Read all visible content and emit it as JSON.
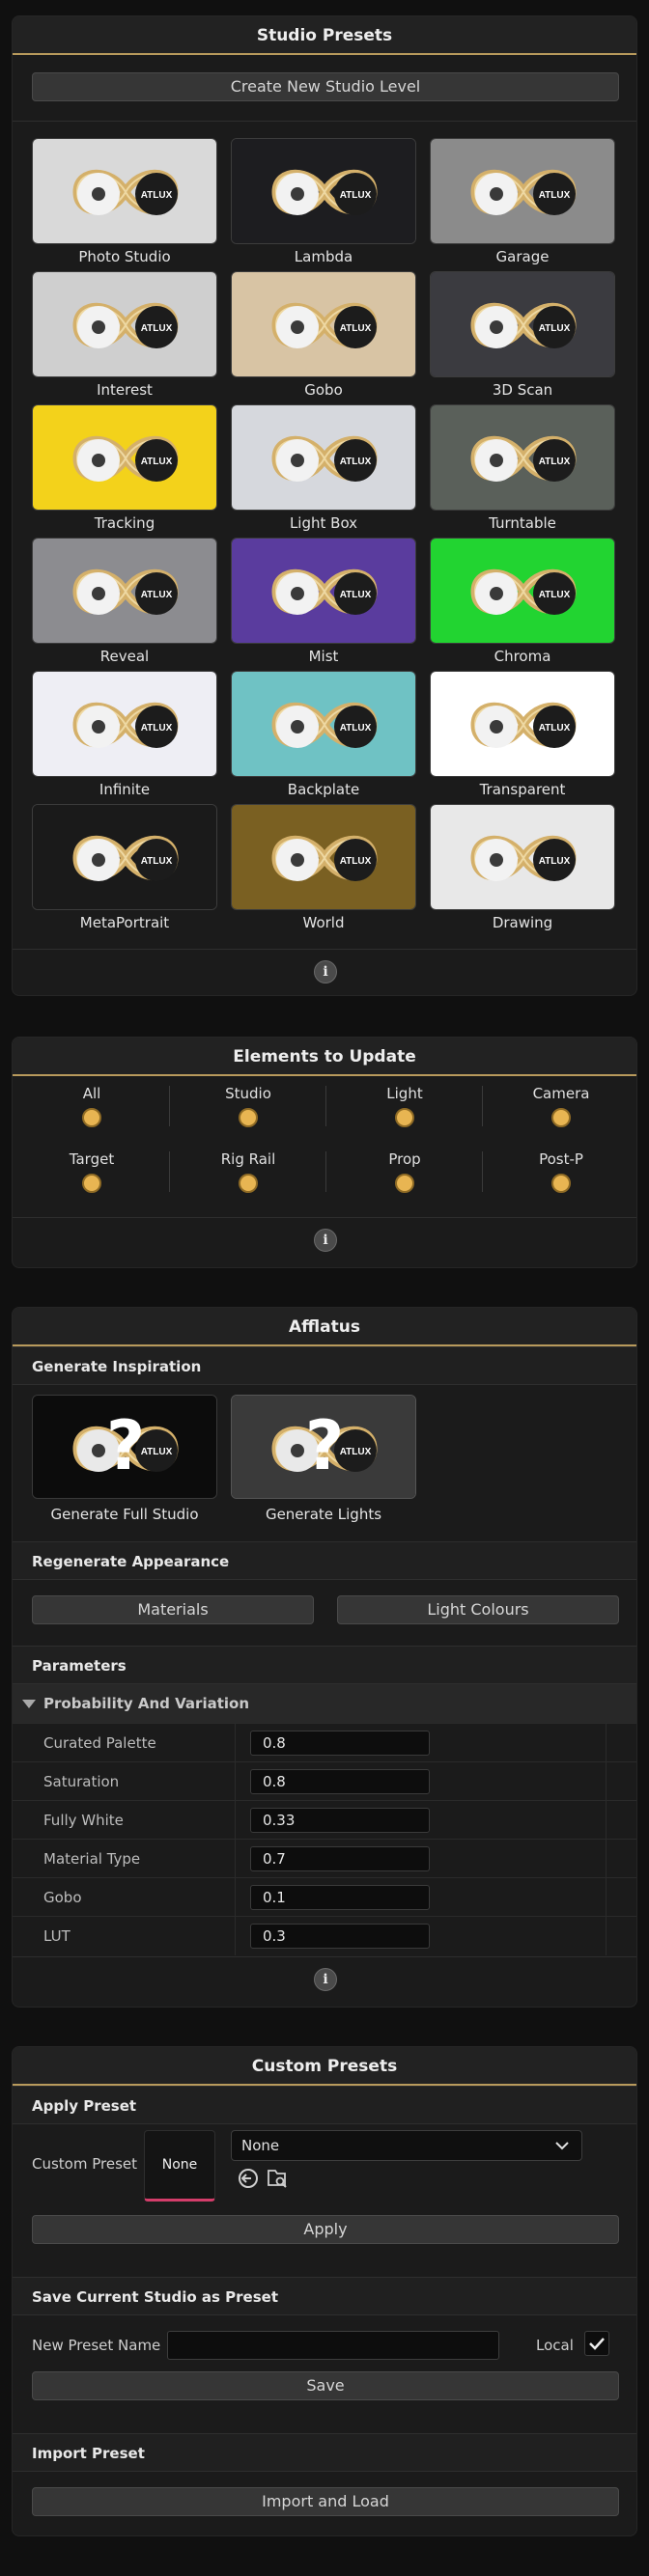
{
  "studio_presets": {
    "title": "Studio Presets",
    "create_button": "Create New Studio Level",
    "presets": [
      {
        "label": "Photo Studio",
        "bg": "#d9d9d9"
      },
      {
        "label": "Lambda",
        "bg": "#1d1d20"
      },
      {
        "label": "Garage",
        "bg": "#8b8b8b"
      },
      {
        "label": "Interest",
        "bg": "#cfcfcf"
      },
      {
        "label": "Gobo",
        "bg": "#d8c4a4"
      },
      {
        "label": "3D Scan",
        "bg": "#3b3b40"
      },
      {
        "label": "Tracking",
        "bg": "#f3d21b"
      },
      {
        "label": "Light Box",
        "bg": "#d6d8dd"
      },
      {
        "label": "Turntable",
        "bg": "#5a605a"
      },
      {
        "label": "Reveal",
        "bg": "#8c8c90"
      },
      {
        "label": "Mist",
        "bg": "#5a3c9e"
      },
      {
        "label": "Chroma",
        "bg": "#22d431"
      },
      {
        "label": "Infinite",
        "bg": "#eeeef4"
      },
      {
        "label": "Backplate",
        "bg": "#6fc2c4"
      },
      {
        "label": "Transparent",
        "bg": "#ffffff"
      },
      {
        "label": "MetaPortrait",
        "bg": "#1a1a1a"
      },
      {
        "label": "World",
        "bg": "#7a6022"
      },
      {
        "label": "Drawing",
        "bg": "#e8e8e8"
      }
    ],
    "info_icon": "info-icon"
  },
  "elements_to_update": {
    "title": "Elements to Update",
    "items": [
      {
        "label": "All"
      },
      {
        "label": "Studio"
      },
      {
        "label": "Light"
      },
      {
        "label": "Camera"
      },
      {
        "label": "Target"
      },
      {
        "label": "Rig Rail"
      },
      {
        "label": "Prop"
      },
      {
        "label": "Post-P"
      }
    ],
    "toggle_color": "#e8b552"
  },
  "afflatus": {
    "title": "Afflatus",
    "generate_inspiration": "Generate Inspiration",
    "cards": [
      {
        "label": "Generate Full Studio",
        "mark": "?"
      },
      {
        "label": "Generate Lights",
        "mark": "?"
      }
    ],
    "regenerate_appearance": "Regenerate Appearance",
    "materials_button": "Materials",
    "light_colours_button": "Light Colours",
    "parameters": "Parameters",
    "probability_group": "Probability And Variation",
    "params": [
      {
        "name": "Curated Palette",
        "value": "0.8"
      },
      {
        "name": "Saturation",
        "value": "0.8"
      },
      {
        "name": "Fully White",
        "value": "0.33"
      },
      {
        "name": "Material Type",
        "value": "0.7"
      },
      {
        "name": "Gobo",
        "value": "0.1"
      },
      {
        "name": "LUT",
        "value": "0.3"
      }
    ]
  },
  "custom_presets": {
    "title": "Custom Presets",
    "apply_preset": "Apply Preset",
    "custom_preset_label": "Custom Preset",
    "thumb_text": "None",
    "select_value": "None",
    "apply_button": "Apply",
    "save_section": "Save Current Studio as Preset",
    "new_preset_name_label": "New Preset Name",
    "new_preset_name_value": "",
    "local_label": "Local",
    "local_checked": true,
    "save_button": "Save",
    "import_section": "Import Preset",
    "import_button": "Import and Load"
  },
  "logo_text": "ATLUX"
}
